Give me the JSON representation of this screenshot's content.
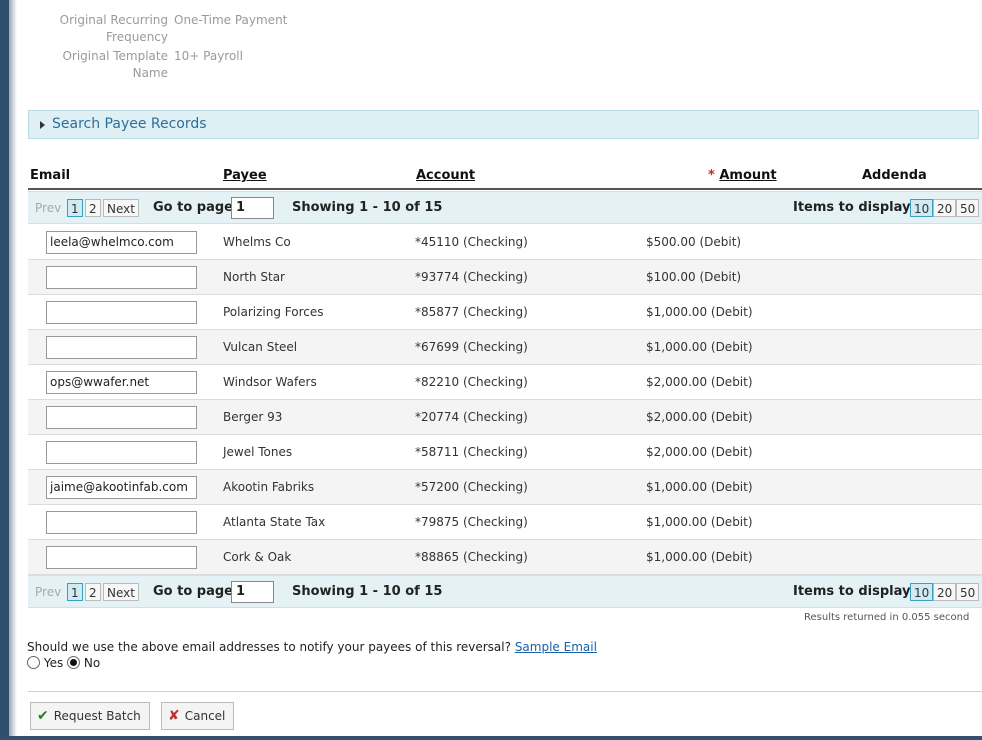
{
  "info": {
    "freq_label_1": "Original Recurring",
    "freq_label_2": "Frequency",
    "freq_value": "One-Time Payment",
    "tmpl_label_1": "Original Template",
    "tmpl_label_2": "Name",
    "tmpl_value": "10+ Payroll"
  },
  "search": {
    "label": "Search Payee Records"
  },
  "columns": {
    "email": "Email",
    "payee": "Payee",
    "account": "Account",
    "amount_req": "*",
    "amount": "Amount",
    "addenda": "Addenda"
  },
  "pager": {
    "prev": "Prev",
    "page1": "1",
    "page2": "2",
    "next": "Next",
    "goto_label": "Go to page",
    "goto_value": "1",
    "showing": "Showing 1 - 10 of 15",
    "items_label": "Items to display:",
    "opt10": "10",
    "opt20": "20",
    "opt50": "50"
  },
  "rows": [
    {
      "email": "leela@whelmco.com",
      "payee": "Whelms Co",
      "account": "*45110 (Checking)",
      "amount": "$500.00 (Debit)"
    },
    {
      "email": "",
      "payee": "North Star",
      "account": "*93774 (Checking)",
      "amount": "$100.00 (Debit)"
    },
    {
      "email": "",
      "payee": "Polarizing Forces",
      "account": "*85877 (Checking)",
      "amount": "$1,000.00 (Debit)"
    },
    {
      "email": "",
      "payee": "Vulcan Steel",
      "account": "*67699 (Checking)",
      "amount": "$1,000.00 (Debit)"
    },
    {
      "email": "ops@wwafer.net",
      "payee": "Windsor Wafers",
      "account": "*82210 (Checking)",
      "amount": "$2,000.00 (Debit)"
    },
    {
      "email": "",
      "payee": "Berger 93",
      "account": "*20774 (Checking)",
      "amount": "$2,000.00 (Debit)"
    },
    {
      "email": "",
      "payee": "Jewel Tones",
      "account": "*58711 (Checking)",
      "amount": "$2,000.00 (Debit)"
    },
    {
      "email": "jaime@akootinfab.com",
      "payee": "Akootin Fabriks",
      "account": "*57200 (Checking)",
      "amount": "$1,000.00 (Debit)"
    },
    {
      "email": "",
      "payee": "Atlanta State Tax",
      "account": "*79875 (Checking)",
      "amount": "$1,000.00 (Debit)"
    },
    {
      "email": "",
      "payee": "Cork & Oak",
      "account": "*88865 (Checking)",
      "amount": "$1,000.00 (Debit)"
    }
  ],
  "results": "Results returned in 0.055 second",
  "notify": {
    "question": "Should we use the above email addresses to notify your payees of this reversal?",
    "sample_link": "Sample Email",
    "yes": "Yes",
    "no": "No"
  },
  "buttons": {
    "request": "Request Batch",
    "cancel": "Cancel"
  }
}
